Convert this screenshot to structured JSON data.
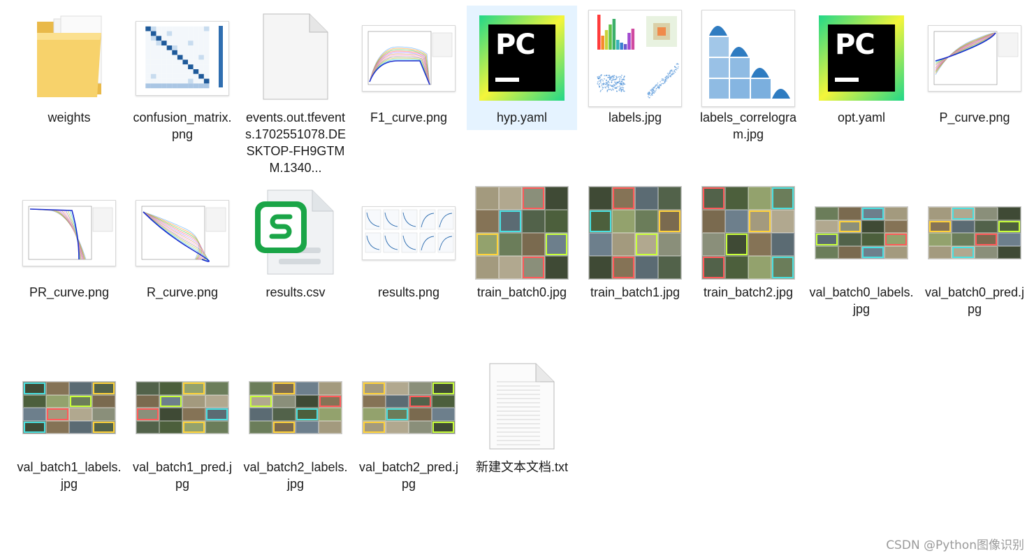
{
  "files": [
    {
      "name": "weights",
      "type": "folder"
    },
    {
      "name": "confusion_matrix.png",
      "type": "confusion"
    },
    {
      "name": "events.out.tfevents.1702551078.DESKTOP-FH9GTMM.1340...",
      "type": "blank-file"
    },
    {
      "name": "F1_curve.png",
      "type": "curve"
    },
    {
      "name": "hyp.yaml",
      "type": "pycharm",
      "selected": true
    },
    {
      "name": "labels.jpg",
      "type": "labels-plot"
    },
    {
      "name": "labels_correlogram.jpg",
      "type": "correlogram"
    },
    {
      "name": "opt.yaml",
      "type": "pycharm"
    },
    {
      "name": "P_curve.png",
      "type": "curve"
    },
    {
      "name": "PR_curve.png",
      "type": "curve"
    },
    {
      "name": "R_curve.png",
      "type": "curve"
    },
    {
      "name": "results.csv",
      "type": "csv"
    },
    {
      "name": "results.png",
      "type": "results"
    },
    {
      "name": "train_batch0.jpg",
      "type": "batch-square"
    },
    {
      "name": "train_batch1.jpg",
      "type": "batch-square"
    },
    {
      "name": "train_batch2.jpg",
      "type": "batch-square"
    },
    {
      "name": "val_batch0_labels.jpg",
      "type": "batch-wide"
    },
    {
      "name": "val_batch0_pred.jpg",
      "type": "batch-wide"
    },
    {
      "name": "val_batch1_labels.jpg",
      "type": "batch-wide"
    },
    {
      "name": "val_batch1_pred.jpg",
      "type": "batch-wide"
    },
    {
      "name": "val_batch2_labels.jpg",
      "type": "batch-wide"
    },
    {
      "name": "val_batch2_pred.jpg",
      "type": "batch-wide"
    },
    {
      "name": "新建文本文档.txt",
      "type": "text-file"
    }
  ],
  "watermark": "CSDN @Python图像识别",
  "colors": {
    "selection": "#e5f3ff",
    "folder": "#f6cf63",
    "pycharm_green": "#21d789",
    "pycharm_yellow": "#f5f53a",
    "csv_green": "#1aa547"
  }
}
